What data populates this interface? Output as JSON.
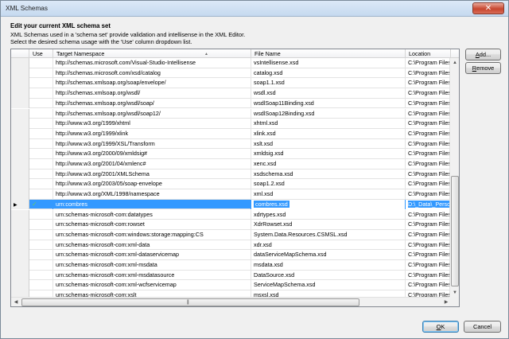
{
  "window": {
    "title": "XML Schemas",
    "close_label": "✕"
  },
  "heading": "Edit your current XML schema set",
  "description_line1": "XML Schemas used in a 'schema set' provide validation and intellisense in the XML Editor.",
  "description_line2": "Select the desired schema usage with the 'Use' column dropdown list.",
  "columns": {
    "use": "Use",
    "namespace": "Target Namespace",
    "file": "File Name",
    "location": "Location"
  },
  "rows": [
    {
      "ns": "http://schemas.microsoft.com/Visual-Studio-Intellisense",
      "file": "vsIntellisense.xsd",
      "loc": "C:\\Program Files (x"
    },
    {
      "ns": "http://schemas.microsoft.com/xsd/catalog",
      "file": "catalog.xsd",
      "loc": "C:\\Program Files (x"
    },
    {
      "ns": "http://schemas.xmlsoap.org/soap/envelope/",
      "file": "soap1.1.xsd",
      "loc": "C:\\Program Files (x"
    },
    {
      "ns": "http://schemas.xmlsoap.org/wsdl/",
      "file": "wsdl.xsd",
      "loc": "C:\\Program Files (x"
    },
    {
      "ns": "http://schemas.xmlsoap.org/wsdl/soap/",
      "file": "wsdlSoap11Binding.xsd",
      "loc": "C:\\Program Files (x"
    },
    {
      "ns": "http://schemas.xmlsoap.org/wsdl/soap12/",
      "file": "wsdlSoap12Binding.xsd",
      "loc": "C:\\Program Files (x"
    },
    {
      "ns": "http://www.w3.org/1999/xhtml",
      "file": "xhtml.xsd",
      "loc": "C:\\Program Files (x"
    },
    {
      "ns": "http://www.w3.org/1999/xlink",
      "file": "xlink.xsd",
      "loc": "C:\\Program Files (x"
    },
    {
      "ns": "http://www.w3.org/1999/XSL/Transform",
      "file": "xslt.xsd",
      "loc": "C:\\Program Files (x"
    },
    {
      "ns": "http://www.w3.org/2000/09/xmldsig#",
      "file": "xmldsig.xsd",
      "loc": "C:\\Program Files (x"
    },
    {
      "ns": "http://www.w3.org/2001/04/xmlenc#",
      "file": "xenc.xsd",
      "loc": "C:\\Program Files (x"
    },
    {
      "ns": "http://www.w3.org/2001/XMLSchema",
      "file": "xsdschema.xsd",
      "loc": "C:\\Program Files (x"
    },
    {
      "ns": "http://www.w3.org/2003/05/soap-envelope",
      "file": "soap1.2.xsd",
      "loc": "C:\\Program Files (x"
    },
    {
      "ns": "http://www.w3.org/XML/1998/namespace",
      "file": "xml.xsd",
      "loc": "C:\\Program Files (x"
    },
    {
      "ns": "urn:combres",
      "file": "combres.xsd",
      "loc": "D:\\_Data\\_Personal\\",
      "selected": true,
      "use": "✓"
    },
    {
      "ns": "urn:schemas-microsoft-com:datatypes",
      "file": "xdrtypes.xsd",
      "loc": "C:\\Program Files (x"
    },
    {
      "ns": "urn:schemas-microsoft-com:rowset",
      "file": "XdrRowset.xsd",
      "loc": "C:\\Program Files (x"
    },
    {
      "ns": "urn:schemas-microsoft-com:windows:storage:mapping:CS",
      "file": "System.Data.Resources.CSMSL.xsd",
      "loc": "C:\\Program Files (x"
    },
    {
      "ns": "urn:schemas-microsoft-com:xml-data",
      "file": "xdr.xsd",
      "loc": "C:\\Program Files (x"
    },
    {
      "ns": "urn:schemas-microsoft-com:xml-dataservicemap",
      "file": "dataServiceMapSchema.xsd",
      "loc": "C:\\Program Files (x"
    },
    {
      "ns": "urn:schemas-microsoft-com:xml-msdata",
      "file": "msdata.xsd",
      "loc": "C:\\Program Files (x"
    },
    {
      "ns": "urn:schemas-microsoft-com:xml-msdatasource",
      "file": "DataSource.xsd",
      "loc": "C:\\Program Files (x"
    },
    {
      "ns": "urn:schemas-microsoft-com:xml-wcfservicemap",
      "file": "ServiceMapSchema.xsd",
      "loc": "C:\\Program Files (x"
    },
    {
      "ns": "urn:schemas-microsoft-com:xslt",
      "file": "msxsl.xsd",
      "loc": "C:\\Program Files (x"
    }
  ],
  "buttons": {
    "add": {
      "pre": "",
      "key": "A",
      "post": "dd..."
    },
    "remove": {
      "pre": "",
      "key": "R",
      "post": "emove"
    },
    "ok": {
      "pre": "",
      "key": "O",
      "post": "K"
    },
    "cancel": {
      "pre": "Cancel"
    }
  },
  "colors": {
    "selection": "#3399ff",
    "use_check": "#66cc66"
  }
}
